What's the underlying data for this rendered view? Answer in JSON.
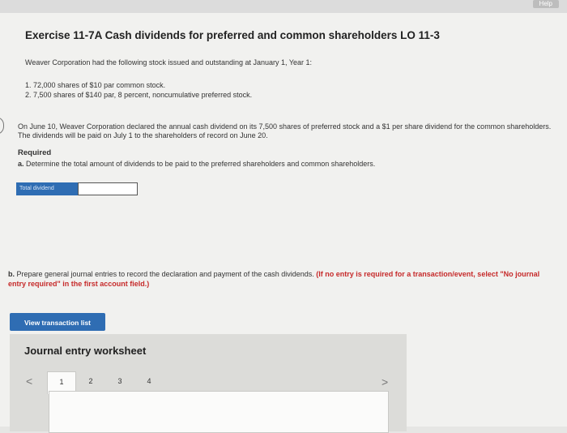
{
  "header": {
    "help_label": "Help"
  },
  "exercise": {
    "title": "Exercise 11-7A Cash dividends for preferred and common shareholders LO 11-3",
    "intro": "Weaver Corporation had the following stock issued and outstanding at January 1, Year 1:",
    "stock_items": [
      "1. 72,000 shares of $10 par common stock.",
      "2. 7,500 shares of $140 par, 8 percent, noncumulative preferred stock."
    ],
    "declaration_text": "On June 10, Weaver Corporation declared the annual cash dividend on its 7,500 shares of preferred stock and a $1 per share dividend for the common shareholders. The dividends will be paid on July 1 to the shareholders of record on June 20."
  },
  "required": {
    "heading": "Required",
    "part_a_letter": "a.",
    "part_a_text": "Determine the total amount of dividends to be paid to the preferred shareholders and common shareholders.",
    "total_dividend_label": "Total dividend",
    "total_dividend_value": "",
    "part_b_letter": "b.",
    "part_b_text": "Prepare general journal entries to record the declaration and payment of the cash dividends.",
    "part_b_note": "(If no entry is required for a transaction/event, select \"No journal entry required\" in the first account field.)"
  },
  "buttons": {
    "view_transaction_list": "View transaction list"
  },
  "worksheet": {
    "title": "Journal entry worksheet",
    "prev_arrow": "<",
    "next_arrow": ">",
    "pages": [
      "1",
      "2",
      "3",
      "4"
    ],
    "active_page": "1"
  }
}
